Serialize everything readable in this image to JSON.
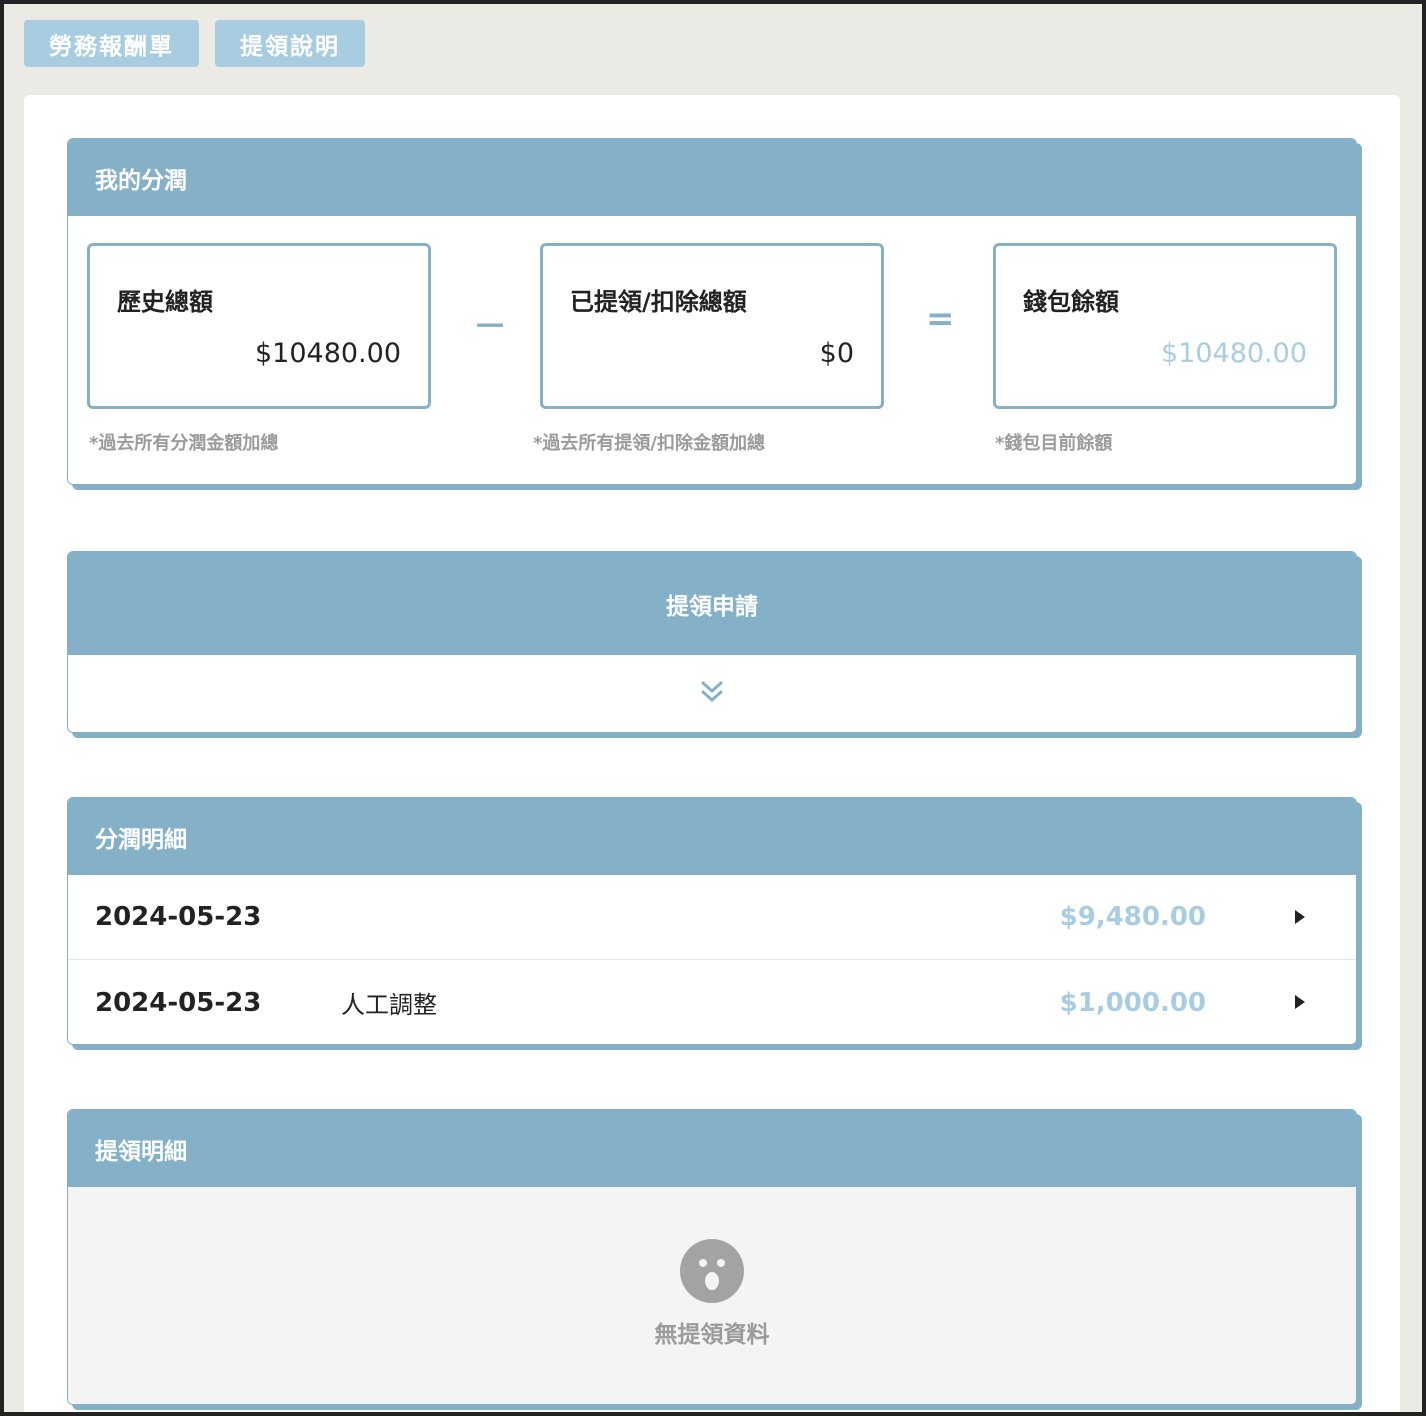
{
  "tabs": [
    {
      "label": "勞務報酬單"
    },
    {
      "label": "提領說明"
    }
  ],
  "profit_card": {
    "title": "我的分潤",
    "history": {
      "label": "歷史總額",
      "value": "$10480.00",
      "note": "*過去所有分潤金額加總"
    },
    "minus_symbol": "－",
    "withdrawn": {
      "label": "已提領/扣除總額",
      "value": "$0",
      "note": "*過去所有提領/扣除金額加總"
    },
    "equals_symbol": "=",
    "balance": {
      "label": "錢包餘額",
      "value": "$10480.00",
      "note": "*錢包目前餘額"
    }
  },
  "apply_card": {
    "title": "提領申請",
    "expand_icon": "double-chevron-down-icon"
  },
  "detail_card": {
    "title": "分潤明細",
    "rows": [
      {
        "date": "2024-05-23",
        "note": "",
        "amount": "$9,480.00"
      },
      {
        "date": "2024-05-23",
        "note": "人工調整",
        "amount": "$1,000.00"
      }
    ]
  },
  "withdraw_card": {
    "title": "提領明細",
    "empty_icon": "surprised-face-icon",
    "empty_text": "無提領資料"
  },
  "colors": {
    "accent": "#85b1c8",
    "accent_light": "#a9cde0",
    "muted_text": "#9b9b9b",
    "page_bg": "#ebeae4"
  }
}
